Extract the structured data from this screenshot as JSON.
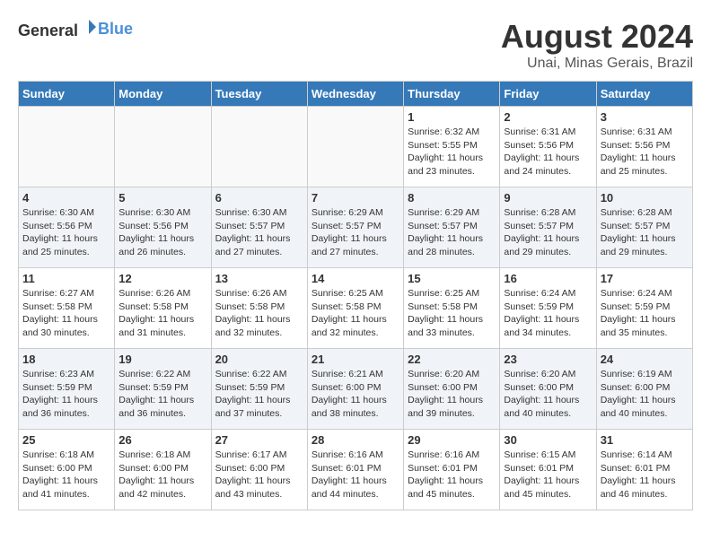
{
  "header": {
    "logo_general": "General",
    "logo_blue": "Blue",
    "month_year": "August 2024",
    "location": "Unai, Minas Gerais, Brazil"
  },
  "days_of_week": [
    "Sunday",
    "Monday",
    "Tuesday",
    "Wednesday",
    "Thursday",
    "Friday",
    "Saturday"
  ],
  "weeks": [
    [
      {
        "day": "",
        "info": ""
      },
      {
        "day": "",
        "info": ""
      },
      {
        "day": "",
        "info": ""
      },
      {
        "day": "",
        "info": ""
      },
      {
        "day": "1",
        "info": "Sunrise: 6:32 AM\nSunset: 5:55 PM\nDaylight: 11 hours and 23 minutes."
      },
      {
        "day": "2",
        "info": "Sunrise: 6:31 AM\nSunset: 5:56 PM\nDaylight: 11 hours and 24 minutes."
      },
      {
        "day": "3",
        "info": "Sunrise: 6:31 AM\nSunset: 5:56 PM\nDaylight: 11 hours and 25 minutes."
      }
    ],
    [
      {
        "day": "4",
        "info": "Sunrise: 6:30 AM\nSunset: 5:56 PM\nDaylight: 11 hours and 25 minutes."
      },
      {
        "day": "5",
        "info": "Sunrise: 6:30 AM\nSunset: 5:56 PM\nDaylight: 11 hours and 26 minutes."
      },
      {
        "day": "6",
        "info": "Sunrise: 6:30 AM\nSunset: 5:57 PM\nDaylight: 11 hours and 27 minutes."
      },
      {
        "day": "7",
        "info": "Sunrise: 6:29 AM\nSunset: 5:57 PM\nDaylight: 11 hours and 27 minutes."
      },
      {
        "day": "8",
        "info": "Sunrise: 6:29 AM\nSunset: 5:57 PM\nDaylight: 11 hours and 28 minutes."
      },
      {
        "day": "9",
        "info": "Sunrise: 6:28 AM\nSunset: 5:57 PM\nDaylight: 11 hours and 29 minutes."
      },
      {
        "day": "10",
        "info": "Sunrise: 6:28 AM\nSunset: 5:57 PM\nDaylight: 11 hours and 29 minutes."
      }
    ],
    [
      {
        "day": "11",
        "info": "Sunrise: 6:27 AM\nSunset: 5:58 PM\nDaylight: 11 hours and 30 minutes."
      },
      {
        "day": "12",
        "info": "Sunrise: 6:26 AM\nSunset: 5:58 PM\nDaylight: 11 hours and 31 minutes."
      },
      {
        "day": "13",
        "info": "Sunrise: 6:26 AM\nSunset: 5:58 PM\nDaylight: 11 hours and 32 minutes."
      },
      {
        "day": "14",
        "info": "Sunrise: 6:25 AM\nSunset: 5:58 PM\nDaylight: 11 hours and 32 minutes."
      },
      {
        "day": "15",
        "info": "Sunrise: 6:25 AM\nSunset: 5:58 PM\nDaylight: 11 hours and 33 minutes."
      },
      {
        "day": "16",
        "info": "Sunrise: 6:24 AM\nSunset: 5:59 PM\nDaylight: 11 hours and 34 minutes."
      },
      {
        "day": "17",
        "info": "Sunrise: 6:24 AM\nSunset: 5:59 PM\nDaylight: 11 hours and 35 minutes."
      }
    ],
    [
      {
        "day": "18",
        "info": "Sunrise: 6:23 AM\nSunset: 5:59 PM\nDaylight: 11 hours and 36 minutes."
      },
      {
        "day": "19",
        "info": "Sunrise: 6:22 AM\nSunset: 5:59 PM\nDaylight: 11 hours and 36 minutes."
      },
      {
        "day": "20",
        "info": "Sunrise: 6:22 AM\nSunset: 5:59 PM\nDaylight: 11 hours and 37 minutes."
      },
      {
        "day": "21",
        "info": "Sunrise: 6:21 AM\nSunset: 6:00 PM\nDaylight: 11 hours and 38 minutes."
      },
      {
        "day": "22",
        "info": "Sunrise: 6:20 AM\nSunset: 6:00 PM\nDaylight: 11 hours and 39 minutes."
      },
      {
        "day": "23",
        "info": "Sunrise: 6:20 AM\nSunset: 6:00 PM\nDaylight: 11 hours and 40 minutes."
      },
      {
        "day": "24",
        "info": "Sunrise: 6:19 AM\nSunset: 6:00 PM\nDaylight: 11 hours and 40 minutes."
      }
    ],
    [
      {
        "day": "25",
        "info": "Sunrise: 6:18 AM\nSunset: 6:00 PM\nDaylight: 11 hours and 41 minutes."
      },
      {
        "day": "26",
        "info": "Sunrise: 6:18 AM\nSunset: 6:00 PM\nDaylight: 11 hours and 42 minutes."
      },
      {
        "day": "27",
        "info": "Sunrise: 6:17 AM\nSunset: 6:00 PM\nDaylight: 11 hours and 43 minutes."
      },
      {
        "day": "28",
        "info": "Sunrise: 6:16 AM\nSunset: 6:01 PM\nDaylight: 11 hours and 44 minutes."
      },
      {
        "day": "29",
        "info": "Sunrise: 6:16 AM\nSunset: 6:01 PM\nDaylight: 11 hours and 45 minutes."
      },
      {
        "day": "30",
        "info": "Sunrise: 6:15 AM\nSunset: 6:01 PM\nDaylight: 11 hours and 45 minutes."
      },
      {
        "day": "31",
        "info": "Sunrise: 6:14 AM\nSunset: 6:01 PM\nDaylight: 11 hours and 46 minutes."
      }
    ]
  ]
}
